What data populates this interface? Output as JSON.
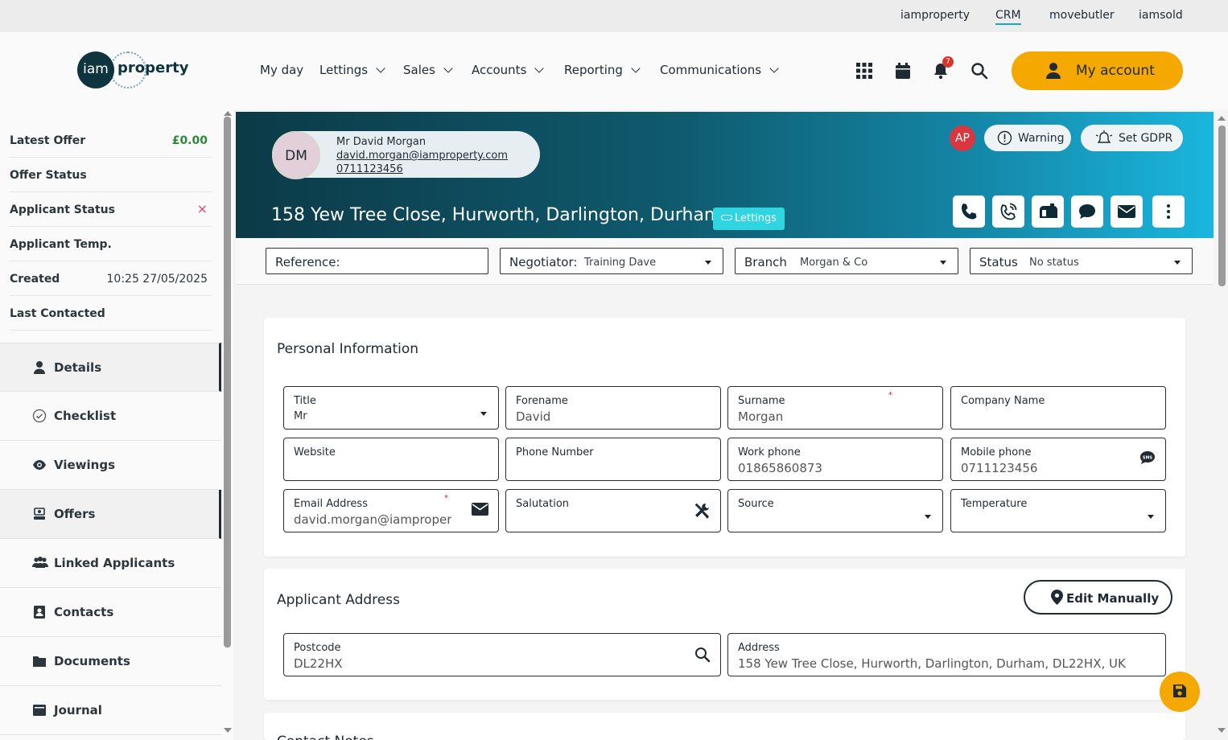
{
  "topbar": {
    "links": [
      "iamproperty",
      "CRM",
      "movebutler",
      "iamsold"
    ],
    "active": "CRM"
  },
  "nav": {
    "logo": {
      "short": "iam",
      "word": "property"
    },
    "menu": [
      "My day",
      "Lettings",
      "Sales",
      "Accounts",
      "Reporting",
      "Communications"
    ],
    "notification_count": "7",
    "my_account": "My account"
  },
  "sidebar": {
    "info": [
      {
        "label": "Latest Offer",
        "value": "£0.00"
      },
      {
        "label": "Offer Status",
        "value": ""
      },
      {
        "label": "Applicant Status",
        "value": "×"
      },
      {
        "label": "Applicant Temp.",
        "value": ""
      },
      {
        "label": "Created",
        "value": "10:25 27/05/2025"
      },
      {
        "label": "Last Contacted",
        "value": ""
      }
    ],
    "items": [
      "Details",
      "Checklist",
      "Viewings",
      "Offers",
      "Linked Applicants",
      "Contacts",
      "Documents",
      "Journal"
    ]
  },
  "hero": {
    "initials": "DM",
    "name": "Mr David Morgan",
    "email": "david.morgan@iamproperty.com",
    "phone": "0711123456",
    "address": "158 Yew Tree Close, Hurworth, Darlington, Durham",
    "tag": "Lettings",
    "user_badge": "AP",
    "warning": "Warning",
    "gdpr": "Set GDPR"
  },
  "filters": {
    "reference": {
      "label": "Reference:",
      "value": ""
    },
    "negotiator": {
      "label": "Negotiator:",
      "value": "Training Dave"
    },
    "branch": {
      "label": "Branch",
      "value": "Morgan & Co"
    },
    "status": {
      "label": "Status",
      "value": "No status"
    }
  },
  "personal": {
    "title": "Personal Information",
    "fields": {
      "title": {
        "label": "Title",
        "value": "Mr"
      },
      "forename": {
        "label": "Forename",
        "value": "David"
      },
      "surname": {
        "label": "Surname",
        "value": "Morgan"
      },
      "company": {
        "label": "Company Name",
        "value": ""
      },
      "website": {
        "label": "Website",
        "value": ""
      },
      "phone": {
        "label": "Phone Number",
        "value": ""
      },
      "work_phone": {
        "label": "Work phone",
        "value": "01865860873"
      },
      "mobile": {
        "label": "Mobile phone",
        "value": "0711123456"
      },
      "email": {
        "label": "Email Address",
        "value": "david.morgan@iamproperty.com"
      },
      "salutation": {
        "label": "Salutation",
        "value": ""
      },
      "source": {
        "label": "Source",
        "value": ""
      },
      "temperature": {
        "label": "Temperature",
        "value": ""
      }
    }
  },
  "address_card": {
    "title": "Applicant Address",
    "edit_manually": "Edit Manually",
    "postcode": {
      "label": "Postcode",
      "value": "DL22HX"
    },
    "address": {
      "label": "Address",
      "value": "158 Yew Tree Close, Hurworth, Darlington, Durham, DL22HX, UK"
    }
  },
  "next_card": {
    "title": "Contact Notes"
  },
  "colors": {
    "accent": "#f5a800",
    "primary_dark": "#0c3a47",
    "tag": "#2fd5e0",
    "danger": "#d9363f"
  }
}
